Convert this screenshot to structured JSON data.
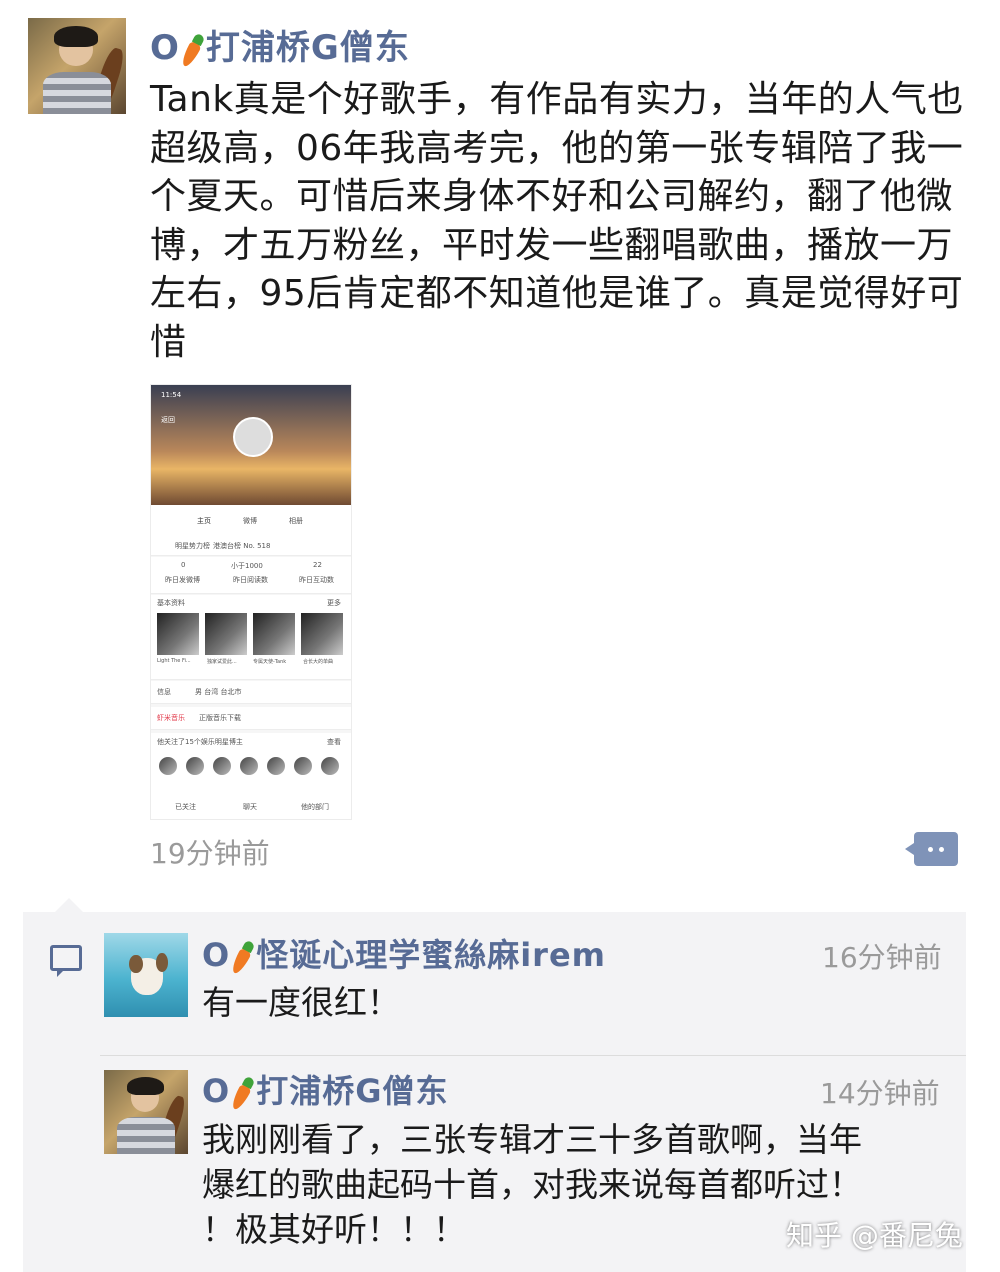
{
  "post": {
    "author_prefix": "O",
    "author_name": "打浦桥G僧东",
    "text": "Tank真是个好歌手，有作品有实力，当年的人气也超级高，06年我高考完，他的第一张专辑陪了我一个夏天。可惜后来身体不好和公司解约，翻了他微博，才五万粉丝，平时发一些翻唱歌曲，播放一万左右，95后肯定都不知道他是谁了。真是觉得好可惜",
    "time": "19分钟前",
    "icons": [
      "comment-icon",
      "carrot-icon"
    ]
  },
  "screenshot": {
    "status_time": "11:54",
    "back": "返回",
    "tabs": [
      "主页",
      "微博",
      "相册"
    ],
    "rank_label": "明星势力榜",
    "rank_value": "港澳台榜 No. 518",
    "stats": [
      {
        "value": "0",
        "label": "昨日发微博"
      },
      {
        "value": "小于1000",
        "label": "昨日阅读数"
      },
      {
        "value": "22",
        "label": "昨日互动数"
      }
    ],
    "basic_info": "基本资料",
    "more": "更多",
    "thumb_captions": [
      "Light The Fi...",
      "独家试爱此...",
      "专属天使-Tank",
      "合长大的单曲"
    ],
    "info_label": "信息",
    "info_value": "男 台湾 台北市",
    "music_brand": "虾米音乐",
    "music_label": "正版音乐下载",
    "follow_text": "他关注了15个娱乐明星博主",
    "follow_more": "查看",
    "actions": [
      "已关注",
      "聊天",
      "他的部门"
    ]
  },
  "comments": [
    {
      "author_prefix": "O",
      "author_name": "怪诞心理学蜜絲麻irem",
      "time": "16分钟前",
      "text": "有一度很红！"
    },
    {
      "author_prefix": "O",
      "author_name": "打浦桥G僧东",
      "time": "14分钟前",
      "text_line1": "我刚刚看了，三张专辑才三十多首歌啊，当年",
      "text_line2": "爆红的歌曲起码十首，对我来说每首都听过！",
      "text_line3": "！极其好听！！！"
    }
  ],
  "watermark": "知乎 @番尼兔"
}
